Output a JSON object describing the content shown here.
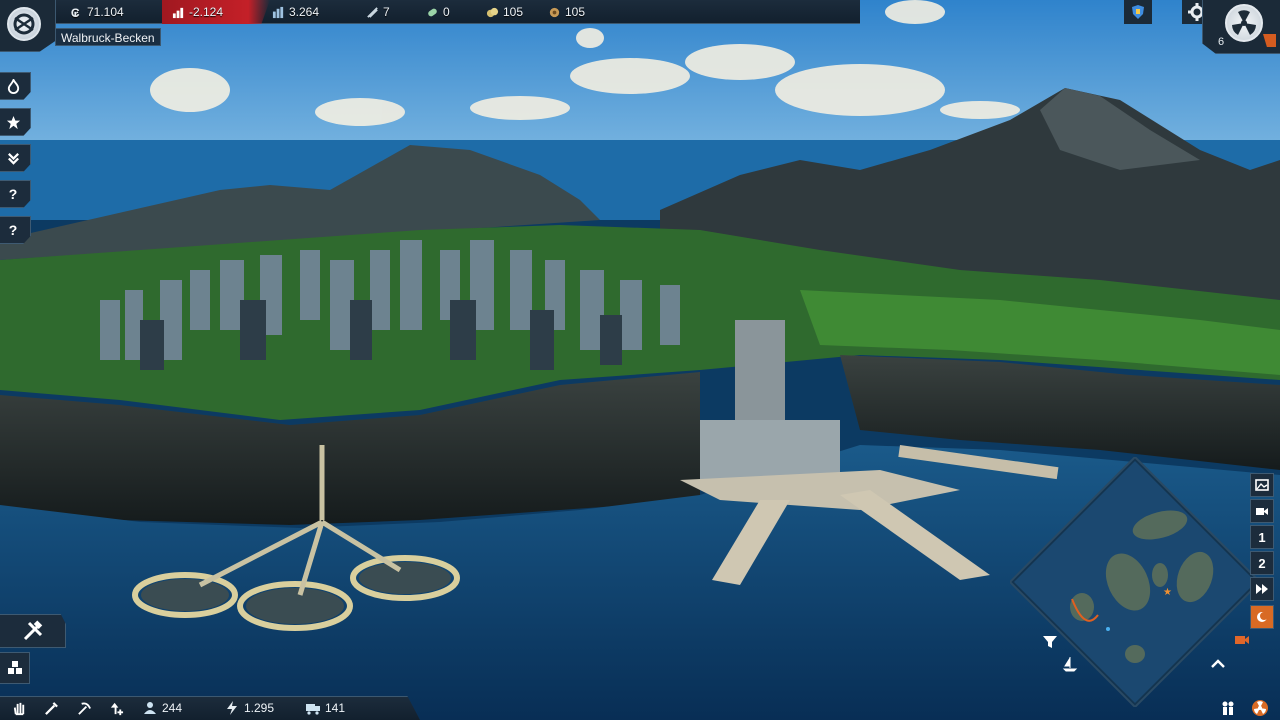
{
  "topbar": {
    "credits": "71.104",
    "balance": "-2.124",
    "influence": "3.264",
    "ships": "7",
    "sailors": "0",
    "goods_a": "105",
    "goods_b": "105"
  },
  "region": "Walbruck-Becken",
  "topright": {
    "count": "6"
  },
  "sidebar": [
    "fire-icon",
    "star-icon",
    "double-chevron-icon",
    "?",
    "?"
  ],
  "bottombar": {
    "population": "244",
    "energy": "1.295",
    "logistics": "141"
  },
  "minimap_controls": [
    "image-icon",
    "camera-icon",
    "1",
    "2",
    "fast-forward-icon"
  ],
  "colors": {
    "ui_panel": "#1c2c3c",
    "ui_border": "#3e5a72",
    "deficit_red": "#c42028",
    "alert_orange": "#d55c20",
    "sea": "#0e3f6c",
    "sky": "#5ea6dc"
  }
}
